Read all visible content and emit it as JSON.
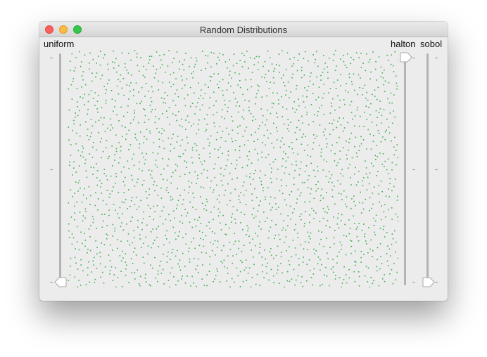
{
  "window": {
    "title": "Random Distributions"
  },
  "sliders": {
    "left_label": "uniform",
    "right_label_1": "halton",
    "right_label_2": "sobol"
  },
  "plot": {
    "dot_color": "#3cb04a",
    "point_count": 2000
  },
  "colors": {
    "window_bg": "#ececec",
    "track": "#b3b3b3"
  }
}
